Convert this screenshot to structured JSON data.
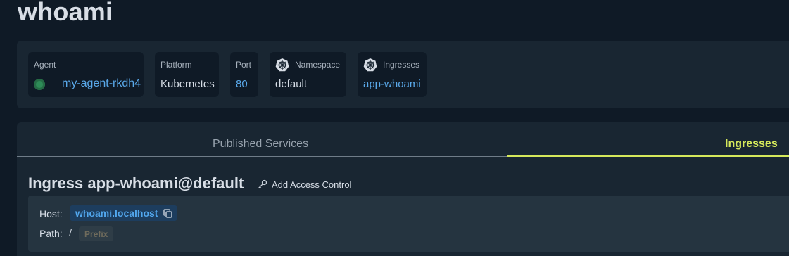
{
  "page": {
    "title": "whoami"
  },
  "info_cards": {
    "agent": {
      "label": "Agent",
      "value": "my-agent-rkdh4",
      "status_color": "#2e8b57"
    },
    "platform": {
      "label": "Platform",
      "value": "Kubernetes"
    },
    "port": {
      "label": "Port",
      "value": "80"
    },
    "namespace": {
      "label": "Namespace",
      "value": "default",
      "icon": "kubernetes-icon"
    },
    "ingresses": {
      "label": "Ingresses",
      "value": "app-whoami",
      "icon": "kubernetes-icon"
    }
  },
  "tabs": [
    {
      "label": "Published Services",
      "active": false
    },
    {
      "label": "Ingresses",
      "active": true
    }
  ],
  "ingress": {
    "title": "Ingress app-whoami@default",
    "add_access_label": "Add Access Control",
    "host_label": "Host:",
    "host_value": "whoami.localhost",
    "path_label": "Path:",
    "path_value": "/",
    "path_type": "Prefix"
  },
  "colors": {
    "accent": "#d5e85b",
    "link": "#5aa9ea",
    "background": "#0f1a26",
    "panel": "#192632"
  }
}
